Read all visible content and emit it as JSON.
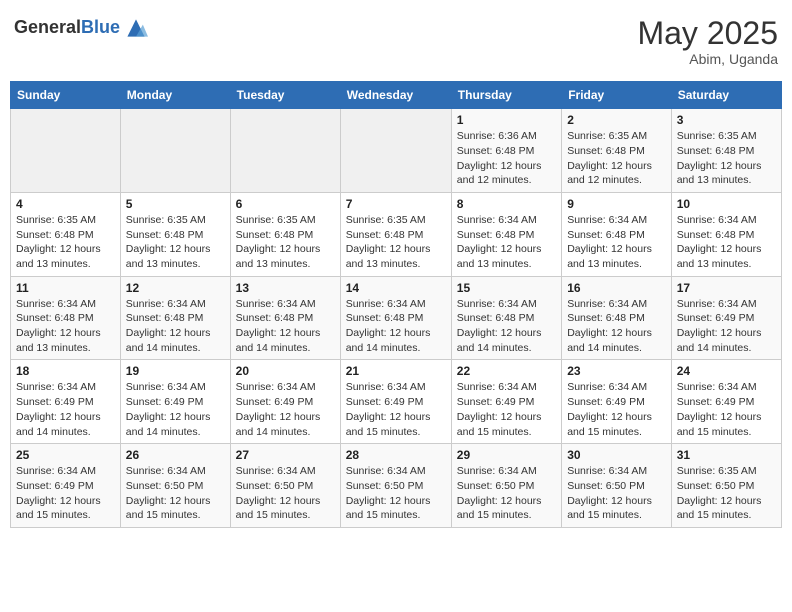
{
  "header": {
    "logo_general": "General",
    "logo_blue": "Blue",
    "month_title": "May 2025",
    "location": "Abim, Uganda"
  },
  "days_of_week": [
    "Sunday",
    "Monday",
    "Tuesday",
    "Wednesday",
    "Thursday",
    "Friday",
    "Saturday"
  ],
  "weeks": [
    [
      {
        "day": "",
        "detail": ""
      },
      {
        "day": "",
        "detail": ""
      },
      {
        "day": "",
        "detail": ""
      },
      {
        "day": "",
        "detail": ""
      },
      {
        "day": "1",
        "detail": "Sunrise: 6:36 AM\nSunset: 6:48 PM\nDaylight: 12 hours\nand 12 minutes."
      },
      {
        "day": "2",
        "detail": "Sunrise: 6:35 AM\nSunset: 6:48 PM\nDaylight: 12 hours\nand 12 minutes."
      },
      {
        "day": "3",
        "detail": "Sunrise: 6:35 AM\nSunset: 6:48 PM\nDaylight: 12 hours\nand 13 minutes."
      }
    ],
    [
      {
        "day": "4",
        "detail": "Sunrise: 6:35 AM\nSunset: 6:48 PM\nDaylight: 12 hours\nand 13 minutes."
      },
      {
        "day": "5",
        "detail": "Sunrise: 6:35 AM\nSunset: 6:48 PM\nDaylight: 12 hours\nand 13 minutes."
      },
      {
        "day": "6",
        "detail": "Sunrise: 6:35 AM\nSunset: 6:48 PM\nDaylight: 12 hours\nand 13 minutes."
      },
      {
        "day": "7",
        "detail": "Sunrise: 6:35 AM\nSunset: 6:48 PM\nDaylight: 12 hours\nand 13 minutes."
      },
      {
        "day": "8",
        "detail": "Sunrise: 6:34 AM\nSunset: 6:48 PM\nDaylight: 12 hours\nand 13 minutes."
      },
      {
        "day": "9",
        "detail": "Sunrise: 6:34 AM\nSunset: 6:48 PM\nDaylight: 12 hours\nand 13 minutes."
      },
      {
        "day": "10",
        "detail": "Sunrise: 6:34 AM\nSunset: 6:48 PM\nDaylight: 12 hours\nand 13 minutes."
      }
    ],
    [
      {
        "day": "11",
        "detail": "Sunrise: 6:34 AM\nSunset: 6:48 PM\nDaylight: 12 hours\nand 13 minutes."
      },
      {
        "day": "12",
        "detail": "Sunrise: 6:34 AM\nSunset: 6:48 PM\nDaylight: 12 hours\nand 14 minutes."
      },
      {
        "day": "13",
        "detail": "Sunrise: 6:34 AM\nSunset: 6:48 PM\nDaylight: 12 hours\nand 14 minutes."
      },
      {
        "day": "14",
        "detail": "Sunrise: 6:34 AM\nSunset: 6:48 PM\nDaylight: 12 hours\nand 14 minutes."
      },
      {
        "day": "15",
        "detail": "Sunrise: 6:34 AM\nSunset: 6:48 PM\nDaylight: 12 hours\nand 14 minutes."
      },
      {
        "day": "16",
        "detail": "Sunrise: 6:34 AM\nSunset: 6:48 PM\nDaylight: 12 hours\nand 14 minutes."
      },
      {
        "day": "17",
        "detail": "Sunrise: 6:34 AM\nSunset: 6:49 PM\nDaylight: 12 hours\nand 14 minutes."
      }
    ],
    [
      {
        "day": "18",
        "detail": "Sunrise: 6:34 AM\nSunset: 6:49 PM\nDaylight: 12 hours\nand 14 minutes."
      },
      {
        "day": "19",
        "detail": "Sunrise: 6:34 AM\nSunset: 6:49 PM\nDaylight: 12 hours\nand 14 minutes."
      },
      {
        "day": "20",
        "detail": "Sunrise: 6:34 AM\nSunset: 6:49 PM\nDaylight: 12 hours\nand 14 minutes."
      },
      {
        "day": "21",
        "detail": "Sunrise: 6:34 AM\nSunset: 6:49 PM\nDaylight: 12 hours\nand 15 minutes."
      },
      {
        "day": "22",
        "detail": "Sunrise: 6:34 AM\nSunset: 6:49 PM\nDaylight: 12 hours\nand 15 minutes."
      },
      {
        "day": "23",
        "detail": "Sunrise: 6:34 AM\nSunset: 6:49 PM\nDaylight: 12 hours\nand 15 minutes."
      },
      {
        "day": "24",
        "detail": "Sunrise: 6:34 AM\nSunset: 6:49 PM\nDaylight: 12 hours\nand 15 minutes."
      }
    ],
    [
      {
        "day": "25",
        "detail": "Sunrise: 6:34 AM\nSunset: 6:49 PM\nDaylight: 12 hours\nand 15 minutes."
      },
      {
        "day": "26",
        "detail": "Sunrise: 6:34 AM\nSunset: 6:50 PM\nDaylight: 12 hours\nand 15 minutes."
      },
      {
        "day": "27",
        "detail": "Sunrise: 6:34 AM\nSunset: 6:50 PM\nDaylight: 12 hours\nand 15 minutes."
      },
      {
        "day": "28",
        "detail": "Sunrise: 6:34 AM\nSunset: 6:50 PM\nDaylight: 12 hours\nand 15 minutes."
      },
      {
        "day": "29",
        "detail": "Sunrise: 6:34 AM\nSunset: 6:50 PM\nDaylight: 12 hours\nand 15 minutes."
      },
      {
        "day": "30",
        "detail": "Sunrise: 6:34 AM\nSunset: 6:50 PM\nDaylight: 12 hours\nand 15 minutes."
      },
      {
        "day": "31",
        "detail": "Sunrise: 6:35 AM\nSunset: 6:50 PM\nDaylight: 12 hours\nand 15 minutes."
      }
    ]
  ]
}
